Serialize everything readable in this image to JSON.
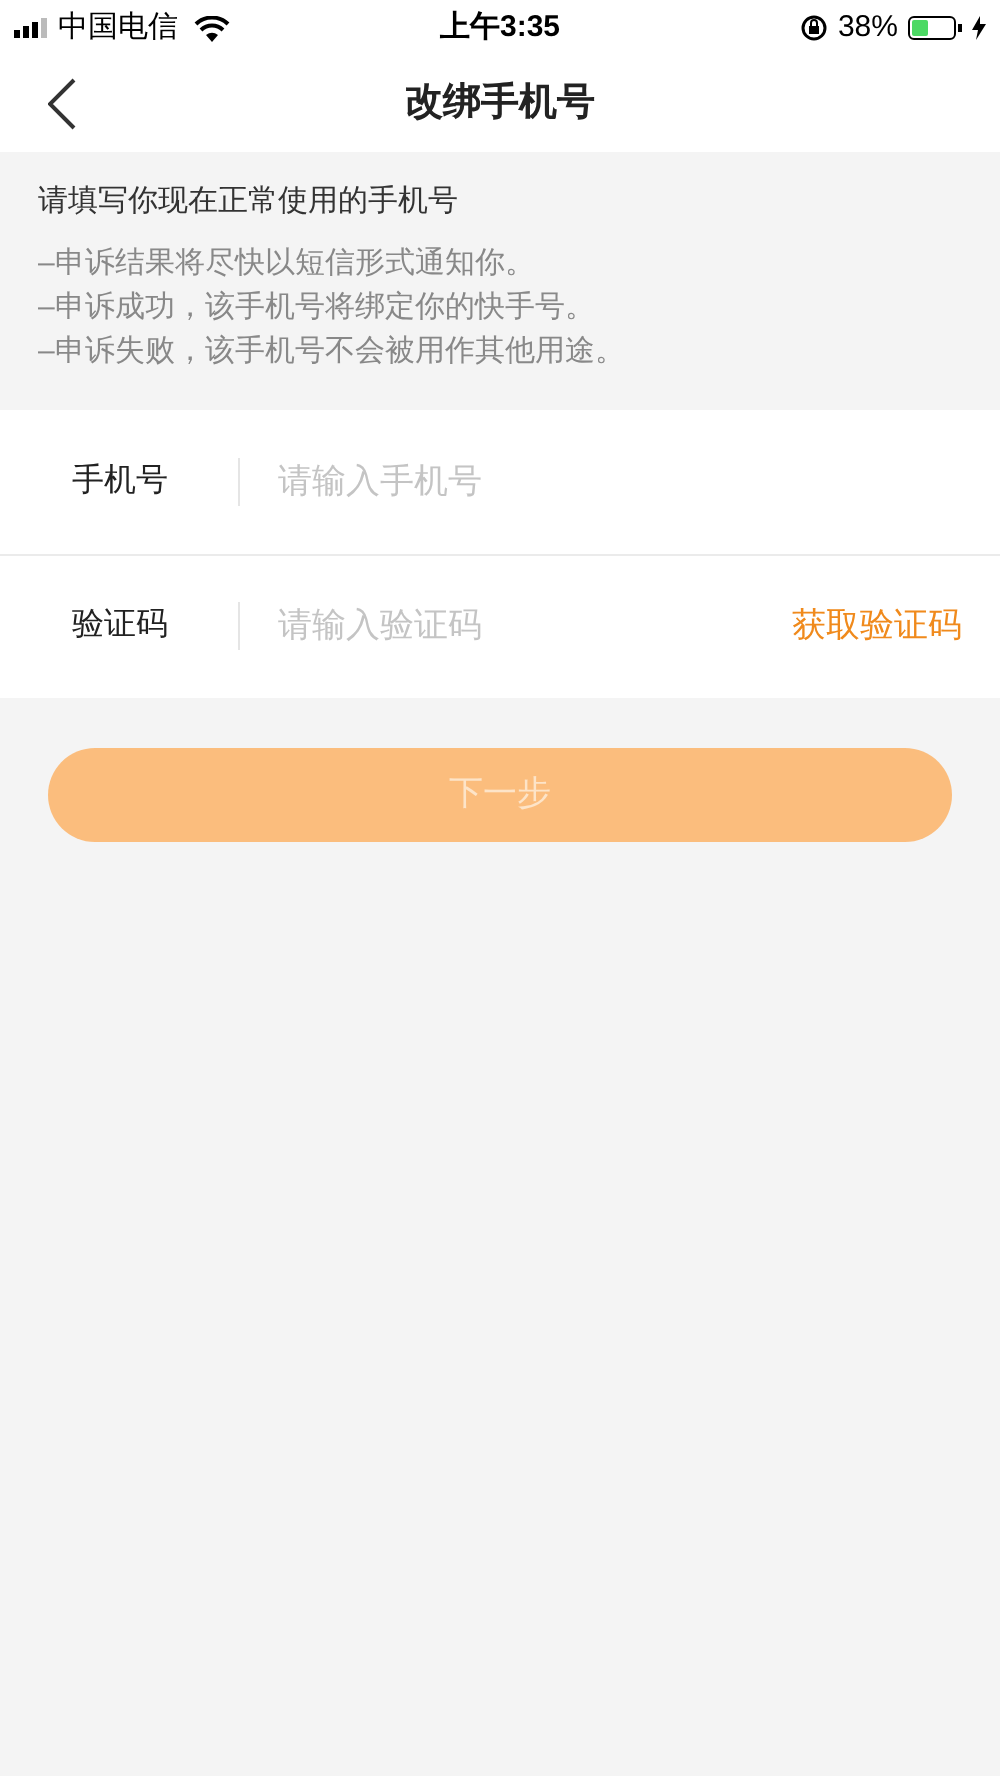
{
  "status_bar": {
    "carrier": "中国电信",
    "time": "上午3:35",
    "battery": "38%"
  },
  "nav": {
    "title": "改绑手机号"
  },
  "notice": {
    "heading": "请填写你现在正常使用的手机号",
    "lines": [
      "–申诉结果将尽快以短信形式通知你。",
      "–申诉成功，该手机号将绑定你的快手号。",
      "–申诉失败，该手机号不会被用作其他用途。"
    ]
  },
  "fields": [
    {
      "kind": "phone",
      "label": "手机号",
      "placeholder": "请输入手机号"
    },
    {
      "kind": "code",
      "label": "验证码",
      "placeholder": "请输入验证码",
      "action": "获取验证码"
    }
  ],
  "next_button": {
    "label": "下一步",
    "disabled": true
  }
}
